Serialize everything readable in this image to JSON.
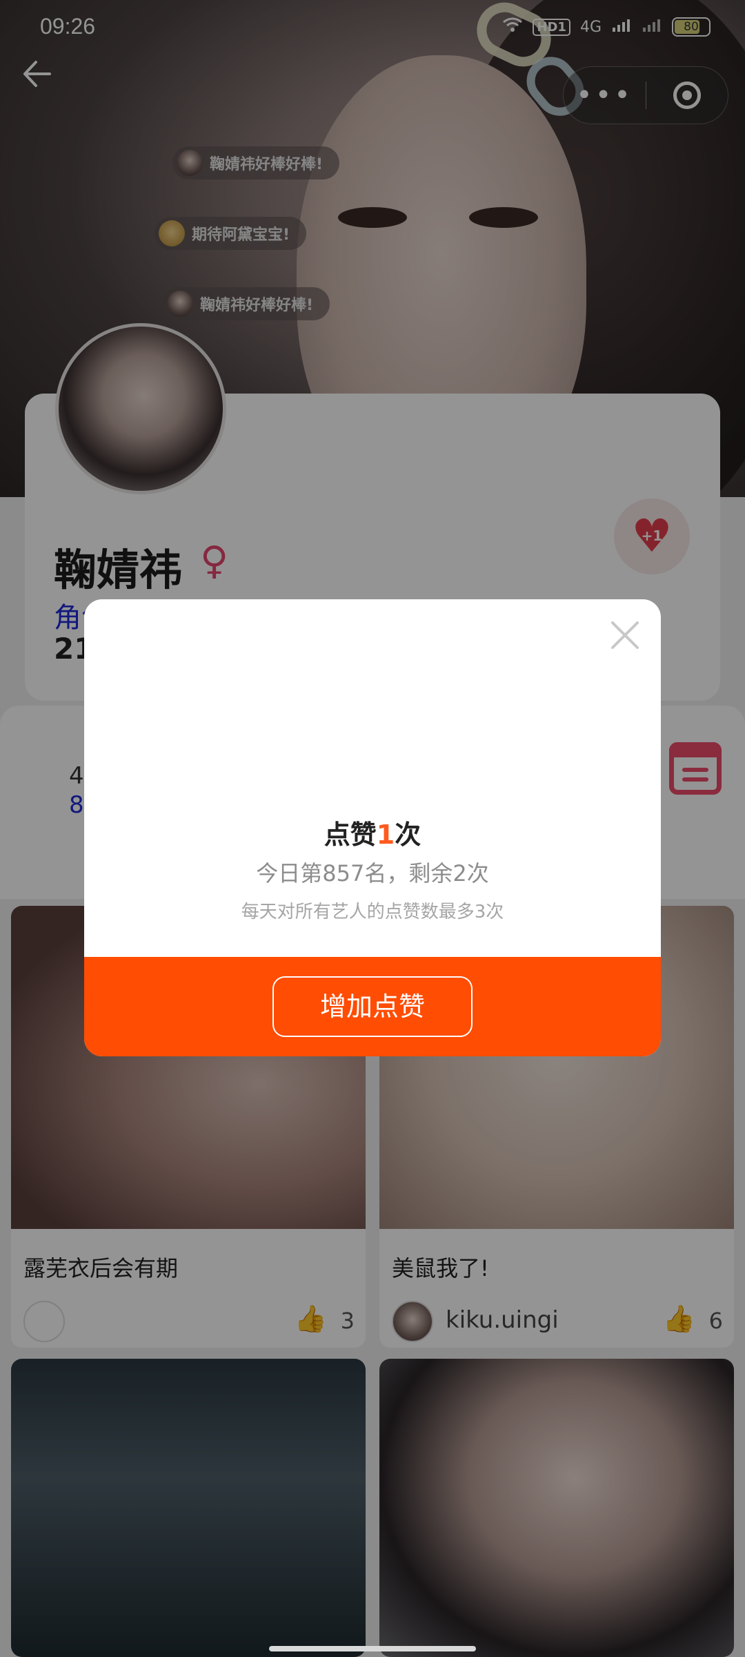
{
  "status_bar": {
    "time": "09:26",
    "network_badge": "HD1",
    "signal_label": "4G",
    "battery": "80"
  },
  "header": {
    "back_icon": "arrow-left-icon",
    "more_icon": "more-dots-icon",
    "close_miniapp_icon": "target-icon"
  },
  "danmaku": [
    {
      "text": "鞠婧祎好棒好棒!"
    },
    {
      "text": "期待阿黛宝宝!"
    },
    {
      "text": "鞠婧祎好棒好棒!"
    }
  ],
  "profile": {
    "name": "鞠婧祎",
    "gender_symbol": "♀",
    "role_text": "角色",
    "count_text": "21",
    "like_button_label": "+1"
  },
  "info_card": {
    "line1": "4",
    "line2": "8"
  },
  "posts": [
    {
      "title": "露芜衣后会有期",
      "user": "",
      "likes": "3"
    },
    {
      "title": "美鼠我了!",
      "user": "kiku.uingi",
      "likes": "6"
    },
    {
      "title": "",
      "user": "",
      "likes": ""
    },
    {
      "title": "",
      "user": "",
      "likes": ""
    }
  ],
  "modal": {
    "headline_prefix": "点赞",
    "headline_count": "1",
    "headline_suffix": "次",
    "rank_text": "今日第857名，剩余2次",
    "note_text": "每天对所有艺人的点赞数最多3次",
    "button_label": "增加点赞"
  },
  "colors": {
    "accent_orange": "#ff4d04",
    "role_blue": "#1f2bd8",
    "female_pink": "#e6456e"
  }
}
